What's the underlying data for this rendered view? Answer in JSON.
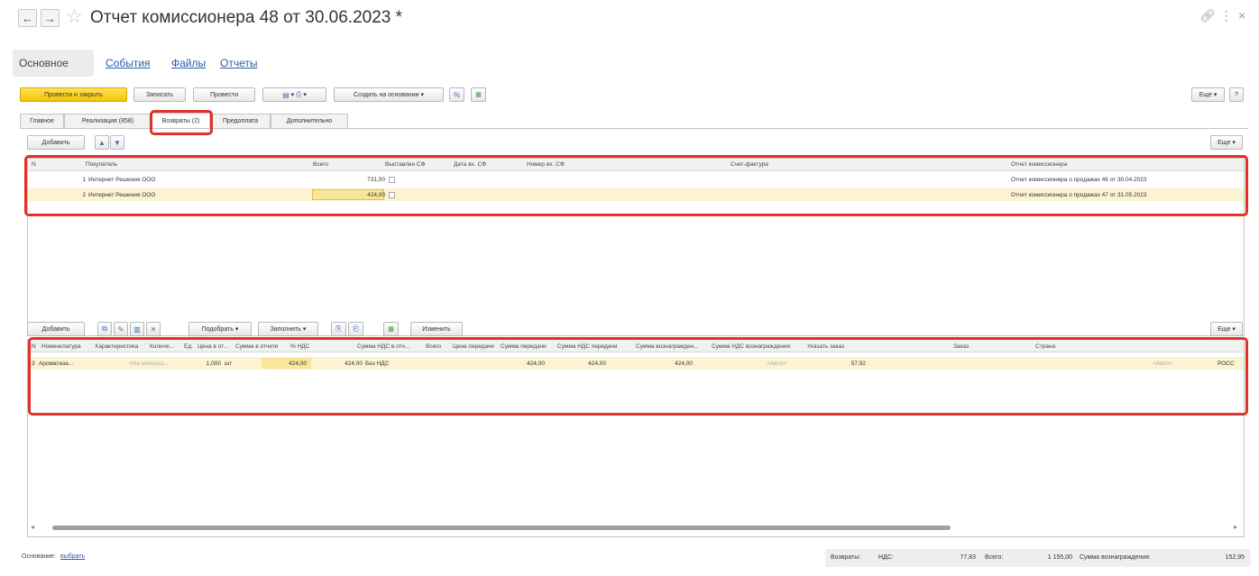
{
  "window": {
    "title": "Отчет комиссионера 48 от 30.06.2023",
    "modified_mark": "*",
    "back_icon": "arrow-left-icon",
    "forward_icon": "arrow-right-icon",
    "star_icon": "star-icon",
    "link_icon": "link-icon",
    "more_icon": "more-vertical-icon",
    "close_icon": "close-icon"
  },
  "sections": [
    "Основное",
    "События",
    "Файлы",
    "Отчеты"
  ],
  "toolbar": {
    "post_close": "Провести и закрыть",
    "save": "Записать",
    "post": "Провести",
    "create_based": "Создать на основании",
    "more": "Еще",
    "help": "?"
  },
  "tabs": [
    "Главное",
    "Реализация (858)",
    "Возвраты (2)",
    "Предоплата",
    "Дополнительно"
  ],
  "upper": {
    "add": "Добавить",
    "more": "Еще",
    "columns": [
      "N",
      "Покупатель",
      "Всего",
      "Выставлен СФ",
      "Дата вх. СФ",
      "Номер вх. СФ",
      "Счет-фактура",
      "Отчет комиссионера"
    ],
    "rows": [
      {
        "n": "1",
        "buyer": "Интернет Решения ООО",
        "total": "731,00",
        "report": "Отчет комиссионера о продажах 46 от 30.04.2023"
      },
      {
        "n": "2",
        "buyer": "Интернет Решения ООО",
        "total": "424,00",
        "report": "Отчет комиссионера о продажах 47 от 31.05.2023"
      }
    ]
  },
  "lower": {
    "add": "Добавить",
    "pick": "Подобрать",
    "fill": "Заполнить",
    "change": "Изменить",
    "more": "Еще",
    "columns": [
      "N",
      "Номенклатура",
      "Характеристика",
      "Количе...",
      "Ед.",
      "Цена в от...",
      "Сумма в отчете",
      "% НДС",
      "Сумма НДС в отч...",
      "Всего",
      "Цена передачи",
      "Сумма передачи",
      "Сумма НДС передачи",
      "Сумма вознагражден...",
      "Сумма НДС вознаграждения",
      "Указать заказ",
      "Заказ",
      "Страна"
    ],
    "row": {
      "n": "3",
      "item": "Ароматиза...",
      "char": "<Не использ...",
      "qty": "1,000",
      "unit": "шт",
      "price": "424,00",
      "sum": "424,00",
      "vat": "Без НДС",
      "total": "424,00",
      "transfer_price": "424,00",
      "transfer_sum": "424,00",
      "vat_transfer": "<Авто>",
      "reward": "57,92",
      "order": "<Авто>",
      "country": "РОСС"
    }
  },
  "footer": {
    "basis_label": "Основание:",
    "basis_link": "выбрать",
    "returns_label": "Возвраты:",
    "vat_label": "НДС:",
    "vat_value": "77,83",
    "total_label": "Всего:",
    "total_value": "1 155,00",
    "reward_label": "Сумма вознаграждения:",
    "reward_value": "152,95"
  },
  "colors": {
    "accent": "#f5c400",
    "highlight": "#e0312b",
    "link": "#2b5ea8"
  }
}
